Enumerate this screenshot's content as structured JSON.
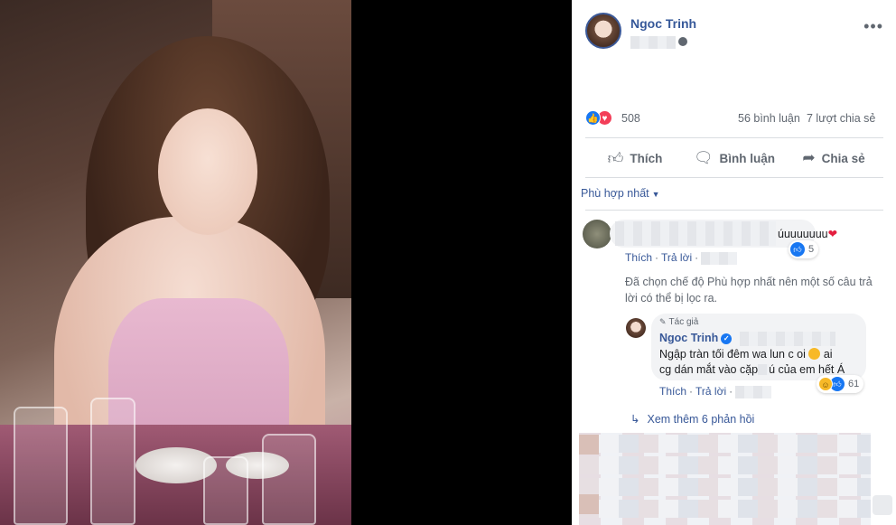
{
  "post": {
    "author": "Ngoc Trinh",
    "more_icon": "more-horizontal-icon",
    "reactions": {
      "count": "508",
      "types": [
        "like",
        "love"
      ]
    },
    "comments_count": "56 bình luận",
    "shares_count": "7 lượt chia sẻ"
  },
  "actions": {
    "like": "Thích",
    "comment": "Bình luận",
    "share": "Chia sẻ"
  },
  "sort": {
    "label": "Phù hợp nhất"
  },
  "comments": [
    {
      "text_visible": "úuuuuuuu",
      "reaction_count": "5",
      "like_link": "Thích",
      "reply_link": "Trả lời"
    }
  ],
  "filter_note": "Đã chọn chế độ Phù hợp nhất nên một số câu trả lời có thể bị lọc ra.",
  "reply": {
    "badge": "Tác giả",
    "author": "Ngoc Trinh",
    "line1": "Ngập tràn tối đêm wa lun c oi",
    "line2_a": "ai",
    "line2_b": "cg dán mắt vào cặp",
    "line2_c": "ú của em hết Á",
    "reaction_count": "61",
    "like_link": "Thích",
    "reply_link": "Trả lời"
  },
  "more_replies": "Xem thêm 6 phản hồi",
  "colors": {
    "link": "#385898",
    "like_blue": "#1877f2",
    "love_red": "#f33e58",
    "muted": "#606770"
  }
}
